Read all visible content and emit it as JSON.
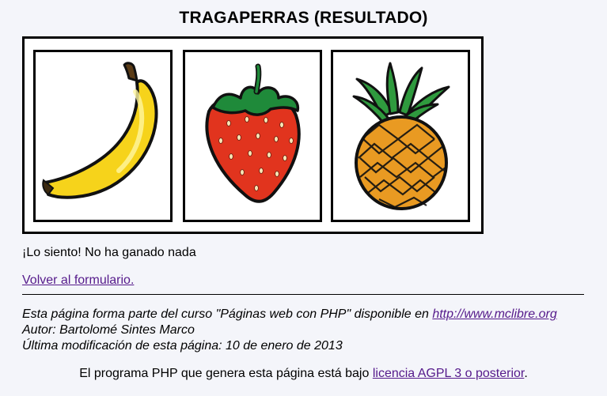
{
  "page": {
    "title": "TRAGAPERRAS (RESULTADO)"
  },
  "slots": [
    {
      "fruit": "banana-icon"
    },
    {
      "fruit": "strawberry-icon"
    },
    {
      "fruit": "pineapple-icon"
    }
  ],
  "result": {
    "message": "¡Lo siento! No ha ganado nada"
  },
  "links": {
    "back": "Volver al formulario."
  },
  "footer": {
    "course_prefix": "Esta página forma parte del curso \"Páginas web con PHP\" disponible en ",
    "course_link": "http://www.mclibre.org",
    "author": "Autor: Bartolomé Sintes Marco",
    "modified": "Última modificación de esta página: 10 de enero de 2013"
  },
  "license": {
    "prefix": "El programa PHP que genera esta página está bajo ",
    "link": "licencia AGPL 3 o posterior",
    "suffix": "."
  },
  "colors": {
    "link": "#551a8b",
    "background": "#f4f5fa"
  }
}
